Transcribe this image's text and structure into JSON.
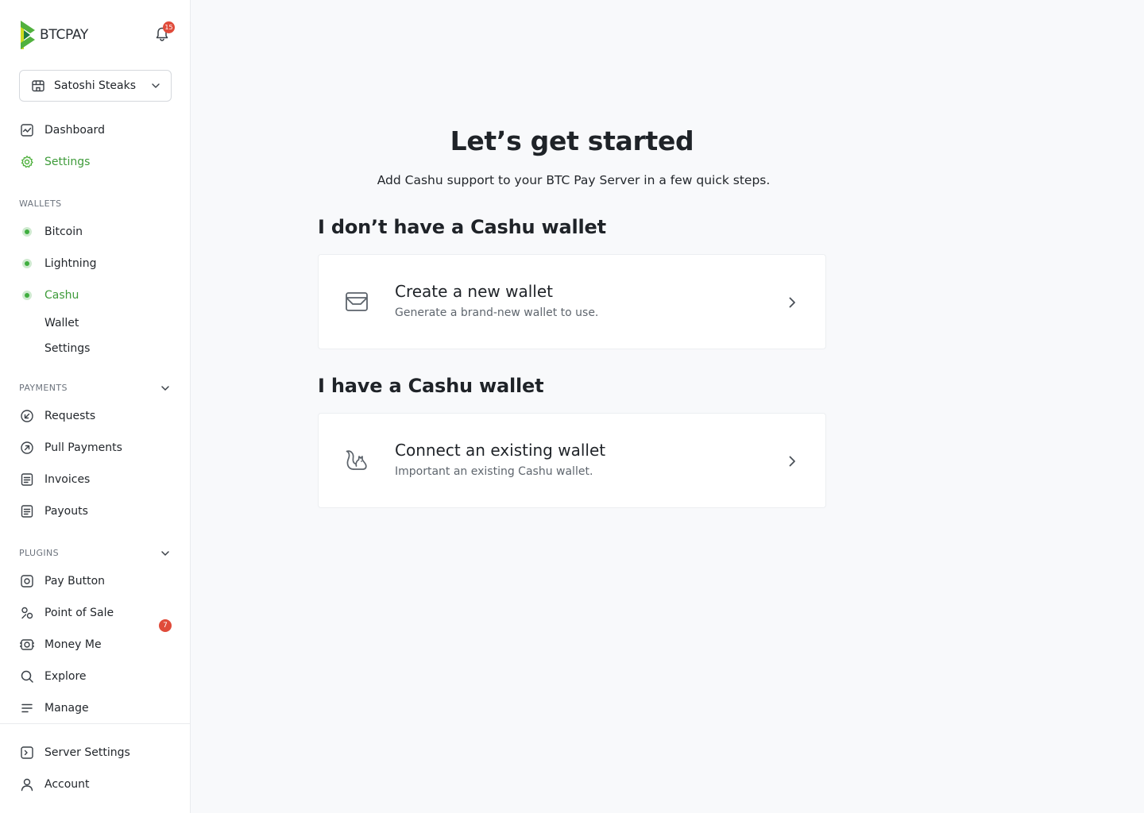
{
  "brand": {
    "name": "BTCPAY",
    "logo_icon": "btcpay-logo-icon"
  },
  "notifications": {
    "count": "15",
    "icon": "bell-icon"
  },
  "store_selector": {
    "name": "Satoshi Steaks",
    "icon": "store-icon",
    "chevron": "chevron-down-icon"
  },
  "nav": {
    "dashboard": "Dashboard",
    "settings": "Settings"
  },
  "wallets": {
    "label": "WALLETS",
    "bitcoin": "Bitcoin",
    "lightning": "Lightning",
    "cashu": "Cashu",
    "cashu_sub": {
      "wallet": "Wallet",
      "settings": "Settings"
    }
  },
  "payments": {
    "label": "PAYMENTS",
    "requests": "Requests",
    "pull_payments": "Pull Payments",
    "invoices": "Invoices",
    "payouts": "Payouts"
  },
  "plugins": {
    "label": "PLUGINS",
    "pay_button": "Pay Button",
    "point_of_sale": "Point of Sale",
    "money_me": "Money Me",
    "money_me_badge": "7",
    "explore": "Explore",
    "manage": "Manage"
  },
  "footer": {
    "server_settings": "Server Settings",
    "account": "Account"
  },
  "main": {
    "title": "Let’s get started",
    "subtitle": "Add Cashu support to your BTC Pay Server in a few quick steps.",
    "no_wallet_heading": "I don’t have a Cashu wallet",
    "have_wallet_heading": "I have a Cashu wallet",
    "create_card": {
      "title": "Create a new wallet",
      "description": "Generate a brand-new wallet to use.",
      "icon": "wallet-icon"
    },
    "connect_card": {
      "title": "Connect an existing wallet",
      "description": "Important an existing Cashu wallet.",
      "icon": "squirrel-icon"
    }
  },
  "colors": {
    "accent_green": "#3e9b3a",
    "badge_red": "#e04b3a",
    "background": "#f8f9fb"
  }
}
